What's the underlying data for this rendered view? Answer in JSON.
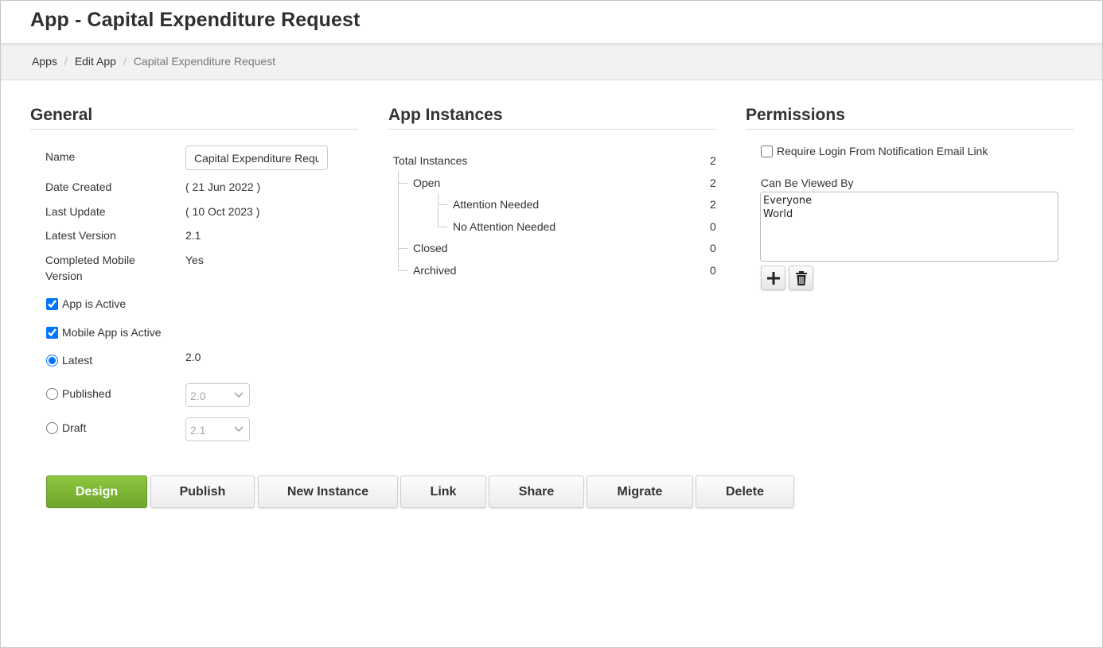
{
  "header": {
    "title": "App - Capital Expenditure Request"
  },
  "breadcrumb": [
    {
      "label": "Apps"
    },
    {
      "label": "Edit App"
    },
    {
      "label": "Capital Expenditure Request"
    }
  ],
  "general": {
    "title": "General",
    "name_label": "Name",
    "name_value": "Capital Expenditure Request",
    "date_created_label": "Date Created",
    "date_created_value": "( 21 Jun 2022 )",
    "last_update_label": "Last Update",
    "last_update_value": "( 10 Oct 2023 )",
    "latest_version_label": "Latest Version",
    "latest_version_value": "2.1",
    "completed_mobile_label_1": "Completed Mobile",
    "completed_mobile_label_2": "Version",
    "completed_mobile_value": "Yes",
    "app_active_label": "App is Active",
    "app_active_checked": true,
    "mobile_active_label": "Mobile App is Active",
    "mobile_active_checked": true,
    "latest_label": "Latest",
    "latest_value": "2.0",
    "published_label": "Published",
    "published_select": "2.0",
    "draft_label": "Draft",
    "draft_select": "2.1",
    "selected_radio": "latest"
  },
  "instances": {
    "title": "App Instances",
    "rows": [
      {
        "label": "Total Instances",
        "count": "2"
      },
      {
        "label": "Open",
        "count": "2"
      },
      {
        "label": "Attention Needed",
        "count": "2"
      },
      {
        "label": "No Attention Needed",
        "count": "0"
      },
      {
        "label": "Closed",
        "count": "0"
      },
      {
        "label": "Archived",
        "count": "0"
      }
    ]
  },
  "permissions": {
    "title": "Permissions",
    "require_login_label": "Require Login From Notification Email Link",
    "require_login_checked": false,
    "viewed_by_label": "Can Be Viewed By",
    "viewers": [
      "Everyone",
      "World"
    ],
    "add_icon": "plus-icon",
    "delete_icon": "trash-icon"
  },
  "actions": {
    "design": "Design",
    "publish": "Publish",
    "new_instance": "New Instance",
    "link": "Link",
    "share": "Share",
    "migrate": "Migrate",
    "delete": "Delete"
  },
  "colors": {
    "primary_green": "#7ab434"
  }
}
